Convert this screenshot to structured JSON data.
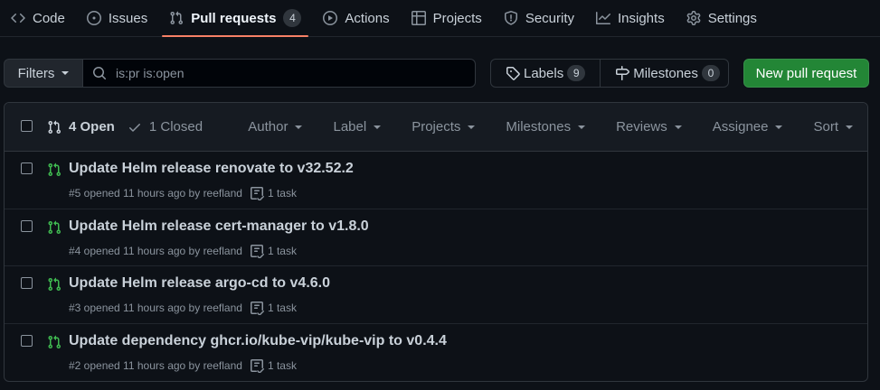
{
  "nav": {
    "items": [
      {
        "label": "Code",
        "icon": "code-icon"
      },
      {
        "label": "Issues",
        "icon": "issue-opened-icon"
      },
      {
        "label": "Pull requests",
        "icon": "git-pull-request-icon",
        "counter": "4",
        "selected": true
      },
      {
        "label": "Actions",
        "icon": "play-icon"
      },
      {
        "label": "Projects",
        "icon": "table-icon"
      },
      {
        "label": "Security",
        "icon": "shield-icon"
      },
      {
        "label": "Insights",
        "icon": "graph-icon"
      },
      {
        "label": "Settings",
        "icon": "gear-icon"
      }
    ]
  },
  "subnav": {
    "filters_label": "Filters",
    "search_value": "is:pr is:open",
    "labels_label": "Labels",
    "labels_count": "9",
    "milestones_label": "Milestones",
    "milestones_count": "0",
    "new_pr_label": "New pull request"
  },
  "list": {
    "open_label": "4 Open",
    "closed_label": "1 Closed",
    "menus": [
      "Author",
      "Label",
      "Projects",
      "Milestones",
      "Reviews",
      "Assignee",
      "Sort"
    ],
    "rows": [
      {
        "title": "Update Helm release renovate to v32.52.2",
        "meta": "#5 opened 11 hours ago by reefland",
        "tasks": "1 task"
      },
      {
        "title": "Update Helm release cert-manager to v1.8.0",
        "meta": "#4 opened 11 hours ago by reefland",
        "tasks": "1 task"
      },
      {
        "title": "Update Helm release argo-cd to v4.6.0",
        "meta": "#3 opened 11 hours ago by reefland",
        "tasks": "1 task"
      },
      {
        "title": "Update dependency ghcr.io/kube-vip/kube-vip to v0.4.4",
        "meta": "#2 opened 11 hours ago by reefland",
        "tasks": "1 task"
      }
    ]
  },
  "colors": {
    "background": "#0d1117",
    "accent_underline": "#f78166",
    "primary_button": "#238636",
    "open_pr_icon": "#3fb950"
  }
}
